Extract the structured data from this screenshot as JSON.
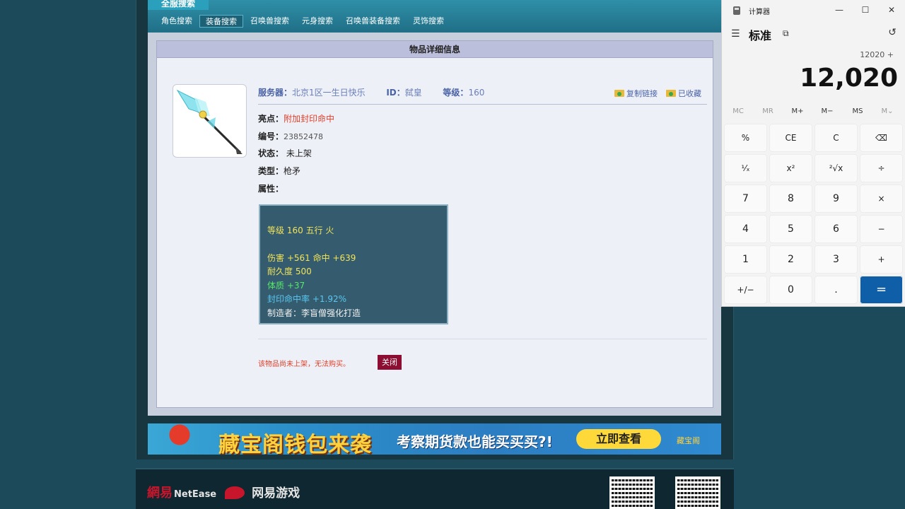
{
  "site": {
    "title": "全服搜索",
    "nav": [
      "角色搜索",
      "装备搜索",
      "召唤兽搜索",
      "元身搜索",
      "召唤兽装备搜索",
      "灵饰搜索"
    ]
  },
  "panel": {
    "header": "物品详细信息",
    "server_label": "服务器：",
    "server_value": "北京1区一生日快乐",
    "id_label": "ID：",
    "id_value": "弑皇",
    "level_label": "等级：",
    "level_value": "160",
    "copy_link": "复制链接",
    "favorited": "已收藏",
    "highlight_label": "亮点：",
    "highlight_value": "附加封印命中",
    "number_label": "编号：",
    "number_value": "23852478",
    "status_label": "状态：",
    "status_value": "未上架",
    "type_label": "类型：",
    "type_value": "枪矛",
    "attr_label": "属性：",
    "attributes": {
      "line1": "等级 160  五行 火",
      "line2": "伤害 +561  命中 +639",
      "line3": "耐久度 500",
      "line4": "体质 +37",
      "line5": "封印命中率 +1.92%",
      "line6": "制造者：李盲僧强化打造"
    },
    "notice": "该物品尚未上架，无法购买。",
    "close_button": "关闭"
  },
  "banner": {
    "title": "藏宝阁钱包来袭",
    "subtitle": "考察期货款也能买买买?!",
    "button": "立即查看",
    "logo": "藏宝阁"
  },
  "footer": {
    "brand_cn": "網易",
    "brand_en": "NetEase",
    "games": "网易游戏"
  },
  "calculator": {
    "window_title": "计算器",
    "mode": "标准",
    "expression": "12020 +",
    "display": "12,020",
    "memory": [
      "MC",
      "MR",
      "M+",
      "M−",
      "MS",
      "M⌄"
    ],
    "keys": [
      [
        "%",
        "CE",
        "C",
        "⌫"
      ],
      [
        "¹⁄ₓ",
        "x²",
        "²√x",
        "÷"
      ],
      [
        "7",
        "8",
        "9",
        "×"
      ],
      [
        "4",
        "5",
        "6",
        "−"
      ],
      [
        "1",
        "2",
        "3",
        "+"
      ],
      [
        "+/−",
        "0",
        ".",
        "="
      ]
    ]
  }
}
